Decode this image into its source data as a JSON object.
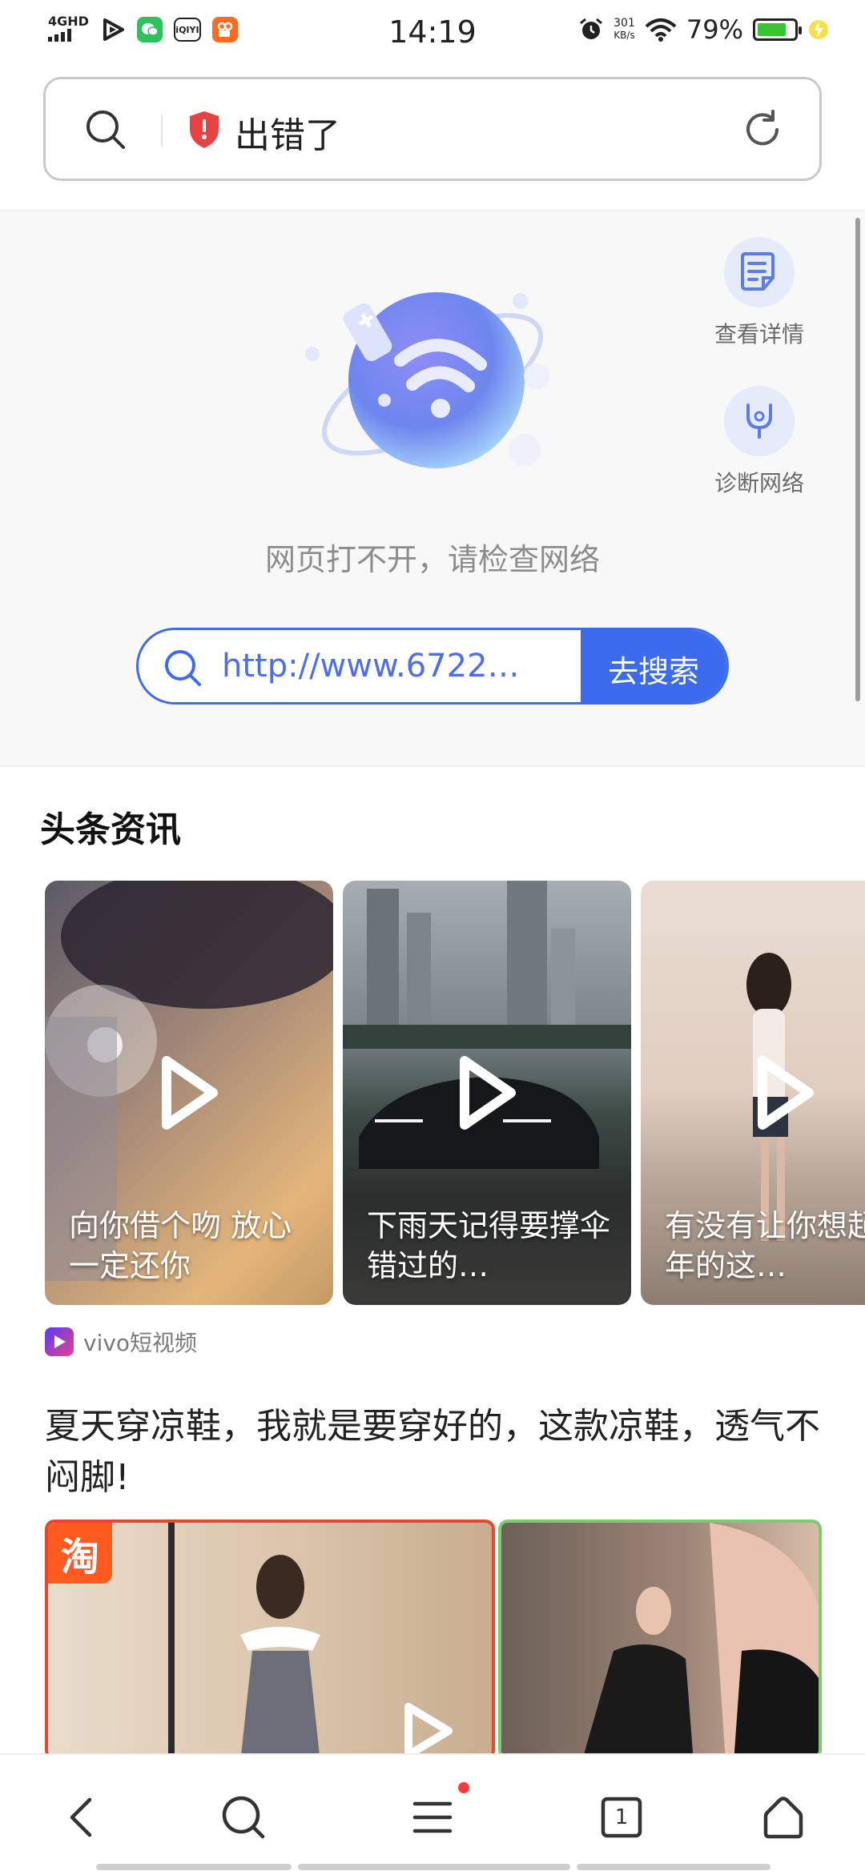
{
  "status_bar": {
    "network": "4GHD",
    "app_icons": [
      "play-icon",
      "wechat-icon",
      "iqiyi-icon",
      "kuaishou-icon"
    ],
    "iqiyi_label": "iQIYI",
    "time": "14:19",
    "net_speed_value": "301",
    "net_speed_unit": "KB/s",
    "battery_percent": "79%",
    "battery_level": 0.79
  },
  "address_bar": {
    "title": "出错了"
  },
  "error_page": {
    "side_actions": [
      {
        "label": "查看详情",
        "icon": "document-icon"
      },
      {
        "label": "诊断网络",
        "icon": "stethoscope-icon"
      }
    ],
    "message": "网页打不开，请检查网络",
    "search_value": "http://www.6722…",
    "search_button": "去搜索"
  },
  "news": {
    "heading": "头条资讯",
    "cards": [
      {
        "caption": "向你借个吻 放心一定还你"
      },
      {
        "caption": "下雨天记得要撑伞 错过的…"
      },
      {
        "caption": "有没有让你想起去年的这…"
      }
    ],
    "source": "vivo短视频"
  },
  "article": {
    "title": "夏天穿凉鞋，我就是要穿好的，这款凉鞋，透气不闷脚!",
    "badge": "淘"
  },
  "bottom_nav": {
    "tab_count": "1",
    "items": [
      "back-icon",
      "search-icon",
      "menu-icon",
      "tabs-icon",
      "home-icon"
    ]
  },
  "colors": {
    "accent": "#3d6bf0",
    "error_shield": "#e84141",
    "battery": "#39c435"
  }
}
